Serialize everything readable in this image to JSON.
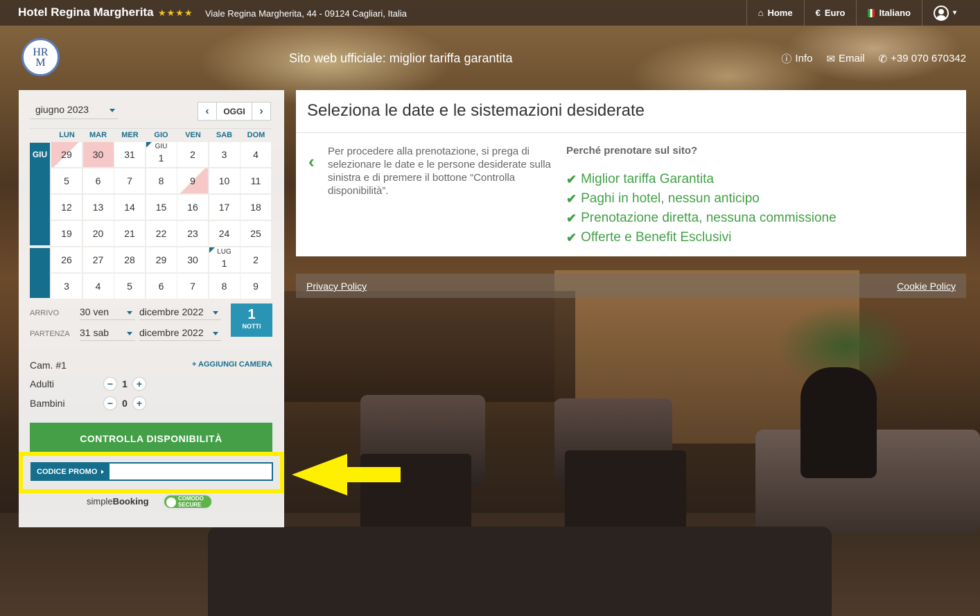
{
  "topbar": {
    "hotel_name": "Hotel Regina Margherita",
    "stars": "★★★★",
    "address": "Viale Regina Margherita, 44 - 09124 Cagliari, Italia",
    "nav": {
      "home": "Home",
      "currency": "Euro",
      "language": "Italiano"
    }
  },
  "header": {
    "logo_text": "HRM",
    "tagline": "Sito web ufficiale: miglior tariffa garantita",
    "info": "Info",
    "email": "Email",
    "phone": "+39 070 670342"
  },
  "calendar": {
    "month_select": "giugno 2023",
    "today_label": "OGGI",
    "weekdays": [
      "LUN",
      "MAR",
      "MER",
      "GIO",
      "VEN",
      "SAB",
      "DOM"
    ],
    "month_labels": {
      "jun": "GIU",
      "jul": "LUG"
    },
    "rows": [
      [
        "29",
        "30",
        "31",
        "1",
        "2",
        "3",
        "4"
      ],
      [
        "5",
        "6",
        "7",
        "8",
        "9",
        "10",
        "11"
      ],
      [
        "12",
        "13",
        "14",
        "15",
        "16",
        "17",
        "18"
      ],
      [
        "19",
        "20",
        "21",
        "22",
        "23",
        "24",
        "25"
      ],
      [
        "26",
        "27",
        "28",
        "29",
        "30",
        "1",
        "2"
      ],
      [
        "3",
        "4",
        "5",
        "6",
        "7",
        "8",
        "9"
      ]
    ],
    "inline_labels": {
      "giu": "GIU",
      "lug": "LUG"
    }
  },
  "stay": {
    "arrival_label": "ARRIVO",
    "arrival_day": "30 ven",
    "arrival_month": "dicembre 2022",
    "departure_label": "PARTENZA",
    "departure_day": "31 sab",
    "departure_month": "dicembre 2022",
    "nights_count": "1",
    "nights_label": "NOTTI"
  },
  "room": {
    "title": "Cam. #1",
    "add_room": "AGGIUNGI CAMERA",
    "adults_label": "Adulti",
    "adults": "1",
    "children_label": "Bambini",
    "children": "0"
  },
  "check_button": "CONTROLLA DISPONIBILITÀ",
  "promo": {
    "label": "CODICE PROMO",
    "value": ""
  },
  "brand": {
    "simple": "simple",
    "booking": "Booking",
    "secure_top": "COMODO",
    "secure_bottom": "SECURE"
  },
  "info": {
    "title": "Seleziona le date e le sistemazioni desiderate",
    "instructions": "Per procedere alla prenotazione, si prega di selezionare le date e le persone desiderate sulla sinistra e di premere il bottone “Controlla disponibilità”.",
    "why_title": "Perché prenotare sul sito?",
    "benefits": [
      "Miglior tariffa Garantita",
      "Paghi in hotel, nessun anticipo",
      "Prenotazione diretta, nessuna commissione",
      "Offerte e Benefit Esclusivi"
    ]
  },
  "footer": {
    "privacy": "Privacy Policy",
    "cookie": "Cookie Policy"
  },
  "colors": {
    "accent": "#146e8c",
    "green": "#43a047",
    "highlight": "#ffef00",
    "selected_day": "#f6c8c8"
  }
}
